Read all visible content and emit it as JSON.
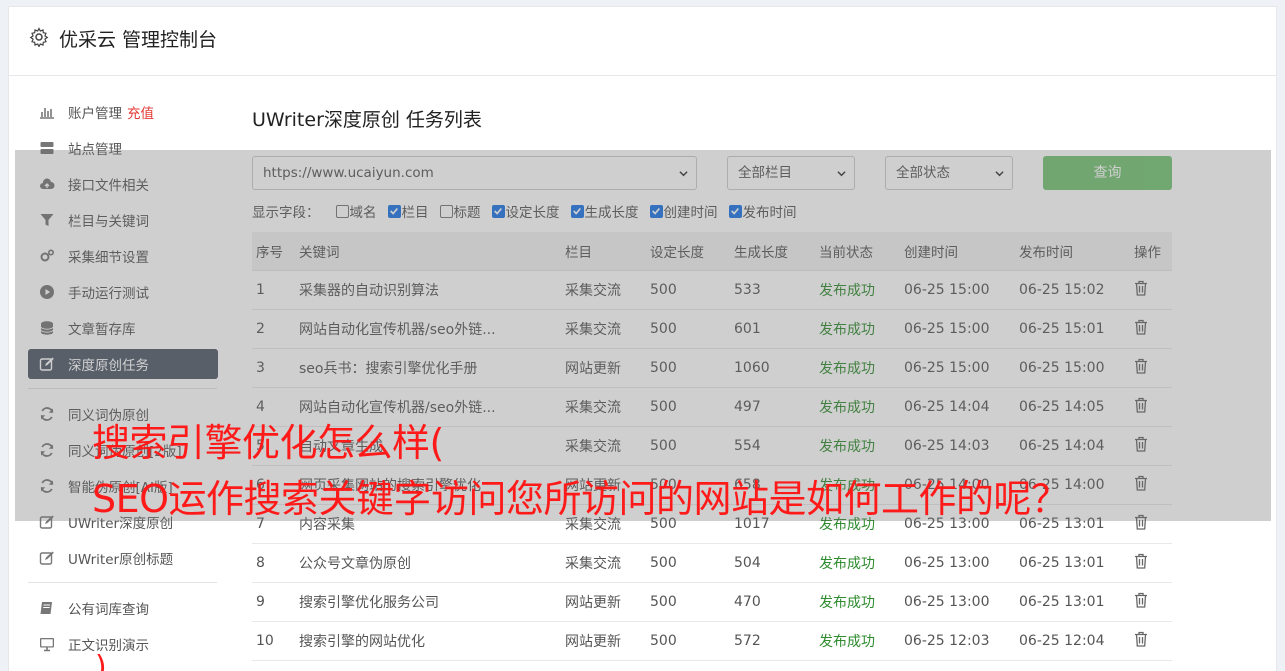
{
  "header": {
    "brand": "优采云 管理控制台"
  },
  "sidebar": {
    "items": [
      {
        "label": "账户管理",
        "extra": "充值",
        "icon": "bar-chart-icon"
      },
      {
        "label": "站点管理",
        "icon": "server-icon"
      },
      {
        "label": "接口文件相关",
        "icon": "cloud-upload-icon"
      },
      {
        "label": "栏目与关键词",
        "icon": "filter-icon"
      },
      {
        "label": "采集细节设置",
        "icon": "gears-icon"
      },
      {
        "label": "手动运行测试",
        "icon": "play-circle-icon"
      },
      {
        "label": "文章暂存库",
        "icon": "database-icon"
      },
      {
        "label": "深度原创任务",
        "icon": "edit-icon",
        "active": true
      }
    ],
    "items2": [
      {
        "label": "同义词伪原创",
        "icon": "refresh-icon"
      },
      {
        "label": "同义词伪原创[2版]",
        "icon": "refresh-icon"
      },
      {
        "label": "智能伪原创[AI版]",
        "icon": "refresh-icon"
      },
      {
        "label": "UWriter深度原创",
        "icon": "edit-icon"
      },
      {
        "label": "UWriter原创标题",
        "icon": "edit-icon"
      }
    ],
    "items3": [
      {
        "label": "公有词库查询",
        "icon": "book-icon"
      },
      {
        "label": "正文识别演示",
        "icon": "monitor-icon"
      }
    ]
  },
  "main": {
    "title": "UWriter深度原创 任务列表",
    "site_select": "https://www.ucaiyun.com",
    "column_select": "全部栏目",
    "status_select": "全部状态",
    "query_button": "查询",
    "fields_label": "显示字段：",
    "fields": [
      {
        "label": "域名",
        "checked": false
      },
      {
        "label": "栏目",
        "checked": true
      },
      {
        "label": "标题",
        "checked": false
      },
      {
        "label": "设定长度",
        "checked": true
      },
      {
        "label": "生成长度",
        "checked": true
      },
      {
        "label": "创建时间",
        "checked": true
      },
      {
        "label": "发布时间",
        "checked": true
      }
    ],
    "table": {
      "headers": [
        "序号",
        "关键词",
        "栏目",
        "设定长度",
        "生成长度",
        "当前状态",
        "创建时间",
        "发布时间",
        "操作"
      ],
      "rows": [
        [
          "1",
          "采集器的自动识别算法",
          "采集交流",
          "500",
          "533",
          "发布成功",
          "06-25 15:00",
          "06-25 15:02"
        ],
        [
          "2",
          "网站自动化宣传机器/seo外链...",
          "采集交流",
          "500",
          "601",
          "发布成功",
          "06-25 15:00",
          "06-25 15:01"
        ],
        [
          "3",
          "seo兵书：搜索引擎优化手册",
          "网站更新",
          "500",
          "1060",
          "发布成功",
          "06-25 15:00",
          "06-25 15:00"
        ],
        [
          "4",
          "网站自动化宣传机器/seo外链...",
          "采集交流",
          "500",
          "497",
          "发布成功",
          "06-25 14:04",
          "06-25 14:05"
        ],
        [
          "5",
          "自动文章生成",
          "采集交流",
          "500",
          "554",
          "发布成功",
          "06-25 14:03",
          "06-25 14:04"
        ],
        [
          "6",
          "网页采集网站的搜索引擎优化",
          "网站更新",
          "500",
          "658",
          "发布成功",
          "06-25 14:00",
          "06-25 14:00"
        ],
        [
          "7",
          "内容采集",
          "采集交流",
          "500",
          "1017",
          "发布成功",
          "06-25 13:00",
          "06-25 13:01"
        ],
        [
          "8",
          "公众号文章伪原创",
          "采集交流",
          "500",
          "504",
          "发布成功",
          "06-25 13:00",
          "06-25 13:01"
        ],
        [
          "9",
          "搜索引擎优化服务公司",
          "网站更新",
          "500",
          "470",
          "发布成功",
          "06-25 13:00",
          "06-25 13:01"
        ],
        [
          "10",
          "搜索引擎的网站优化",
          "网站更新",
          "500",
          "572",
          "发布成功",
          "06-25 12:03",
          "06-25 12:04"
        ]
      ]
    }
  },
  "overlay": {
    "line1": "搜索引擎优化怎么样(",
    "line2": "SEO运作搜索关键字访问您所访问的网站是如何工作的呢？",
    "stray": ")"
  },
  "colors": {
    "active_nav": "#4e5867",
    "status_ok": "#2e8b2e",
    "query_button": "#5cb85c",
    "overlay_text": "#ff1a1a"
  }
}
